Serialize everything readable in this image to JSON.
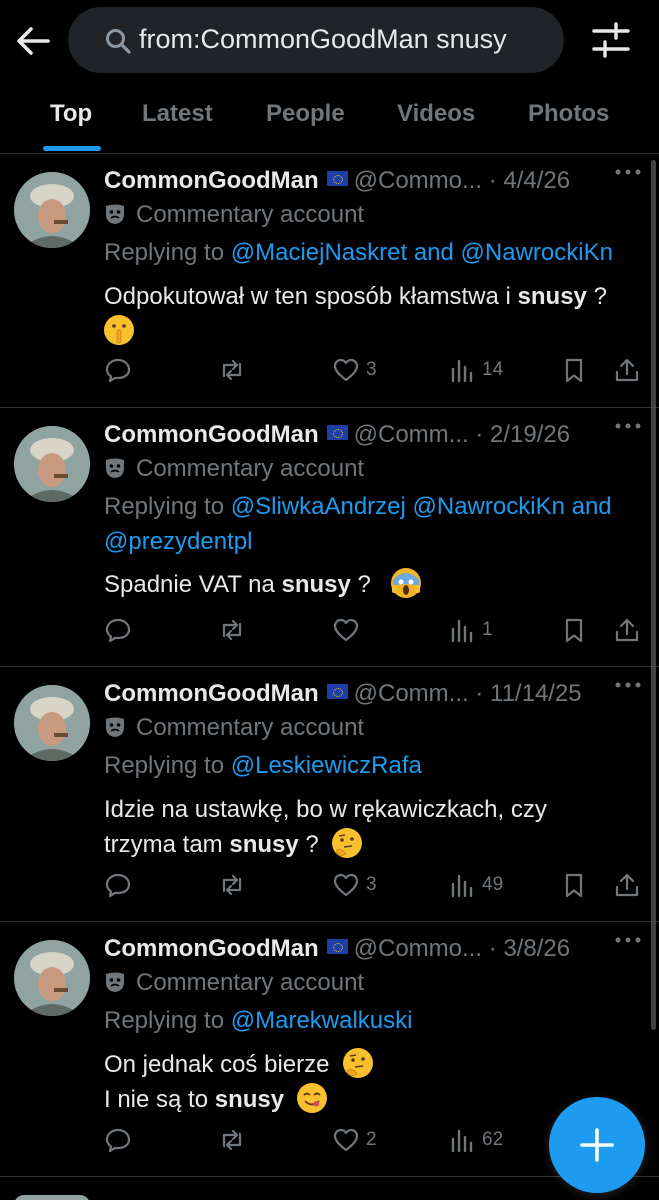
{
  "search": {
    "query": "from:CommonGoodMan snusy"
  },
  "tabs": [
    {
      "label": "Top",
      "active": true
    },
    {
      "label": "Latest"
    },
    {
      "label": "People"
    },
    {
      "label": "Videos"
    },
    {
      "label": "Photos"
    }
  ],
  "posts": [
    {
      "name": "CommonGoodMan",
      "handle": "@Commo...",
      "sep": "·",
      "date": "4/4/26",
      "label": "Commentary account",
      "reply_prefix": "Replying to",
      "reply_mentions": [
        "@MaciejNaskret",
        "@NawrockiKn"
      ],
      "reply_joiner": "and",
      "text_before": "Odpokutował w ten sposób kłamstwa i ",
      "text_bold": "snusy",
      "text_after": " ?",
      "emoji": "shushing-face",
      "likes": "3",
      "views": "14"
    },
    {
      "name": "CommonGoodMan",
      "handle": "@Comm...",
      "sep": "·",
      "date": "2/19/26",
      "label": "Commentary account",
      "reply_prefix": "Replying to",
      "reply_mentions": [
        "@SliwkaAndrzej",
        "@NawrockiKn",
        "@prezydentpl"
      ],
      "reply_joiner": "and",
      "text_before": "Spadnie VAT na ",
      "text_bold": "snusy",
      "text_after": " ?",
      "emoji": "screaming-face",
      "likes": "",
      "views": "1"
    },
    {
      "name": "CommonGoodMan",
      "handle": "@Comm...",
      "sep": "·",
      "date": "11/14/25",
      "label": "Commentary account",
      "reply_prefix": "Replying to",
      "reply_mentions": [
        "@LeskiewiczRafa"
      ],
      "text_line1": "Idzie na ustawkę, bo w rękawiczkach, czy",
      "text_before": "trzyma tam ",
      "text_bold": "snusy",
      "text_after": " ?",
      "emoji": "thinking-face",
      "likes": "3",
      "views": "49"
    },
    {
      "name": "CommonGoodMan",
      "handle": "@Commo...",
      "sep": "·",
      "date": "3/8/26",
      "label": "Commentary account",
      "reply_prefix": "Replying to",
      "reply_mentions": [
        "@Marekwalkuski"
      ],
      "text_line1": "On jednak coś bierze",
      "text_before": "I nie są to ",
      "text_bold": "snusy",
      "text_after": "",
      "emoji": "yum-face",
      "likes": "2",
      "views": "62"
    }
  ],
  "colors": {
    "accent": "#1d9bf0",
    "muted": "#71767b",
    "background": "#000000"
  }
}
